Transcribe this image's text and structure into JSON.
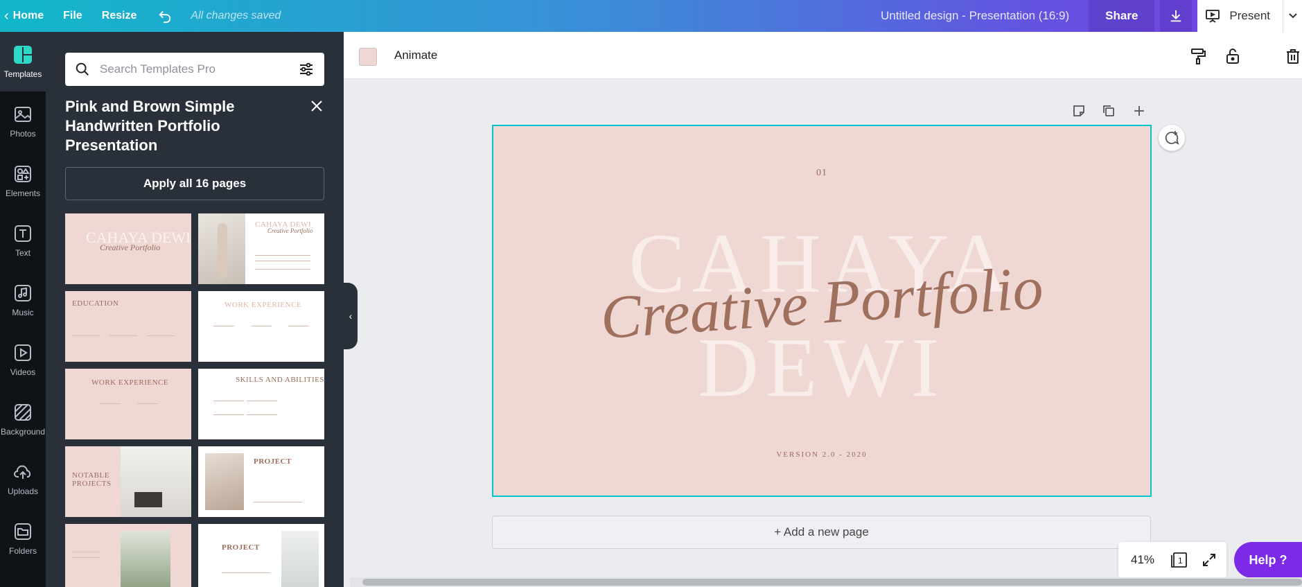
{
  "topbar": {
    "home": "Home",
    "file": "File",
    "resize": "Resize",
    "undo_icon": "undo-icon",
    "saved_status": "All changes saved",
    "design_title": "Untitled design - Presentation (16:9)",
    "share": "Share",
    "present": "Present",
    "gradient_colors": [
      "#11b7c9",
      "#6452e0",
      "#7a3fe4"
    ]
  },
  "rail": {
    "items": [
      {
        "label": "Templates",
        "icon": "templates-icon",
        "active": true
      },
      {
        "label": "Photos",
        "icon": "photos-icon"
      },
      {
        "label": "Elements",
        "icon": "elements-icon"
      },
      {
        "label": "Text",
        "icon": "text-icon"
      },
      {
        "label": "Music",
        "icon": "music-icon"
      },
      {
        "label": "Videos",
        "icon": "videos-icon"
      },
      {
        "label": "Background",
        "icon": "background-icon"
      },
      {
        "label": "Uploads",
        "icon": "uploads-icon"
      },
      {
        "label": "Folders",
        "icon": "folders-icon"
      }
    ]
  },
  "panel": {
    "search_placeholder": "Search Templates Pro",
    "template_title": "Pink and Brown Simple Handwritten Portfolio Presentation",
    "apply_label": "Apply all 16 pages",
    "thumbnails": [
      {
        "title": "CAHAYA DEWI",
        "script": "Creative Portfolio"
      },
      {
        "title": "CAHAYA DEWI",
        "script": "Creative Portfolio"
      },
      {
        "title": "EDUCATION"
      },
      {
        "title": "WORK EXPERIENCE"
      },
      {
        "title": "WORK EXPERIENCE"
      },
      {
        "title": "SKILLS AND ABILITIES"
      },
      {
        "title": "NOTABLE PROJECTS"
      },
      {
        "title": "PROJECT"
      },
      {
        "title": ""
      },
      {
        "title": "PROJECT"
      }
    ]
  },
  "subbar": {
    "animate": "Animate",
    "swatch_color": "#efd8d3"
  },
  "slide": {
    "number": "01",
    "big_line1": "CAHAYA",
    "big_line2": "DEWI",
    "script": "Creative Portfolio",
    "version": "VERSION 2.0 - 2020",
    "background": "#efd8d3",
    "text_color": "#9a6b5b"
  },
  "canvas": {
    "add_page": "+ Add a new page",
    "zoom": "41%",
    "page_count": "1",
    "help": "Help ?"
  }
}
